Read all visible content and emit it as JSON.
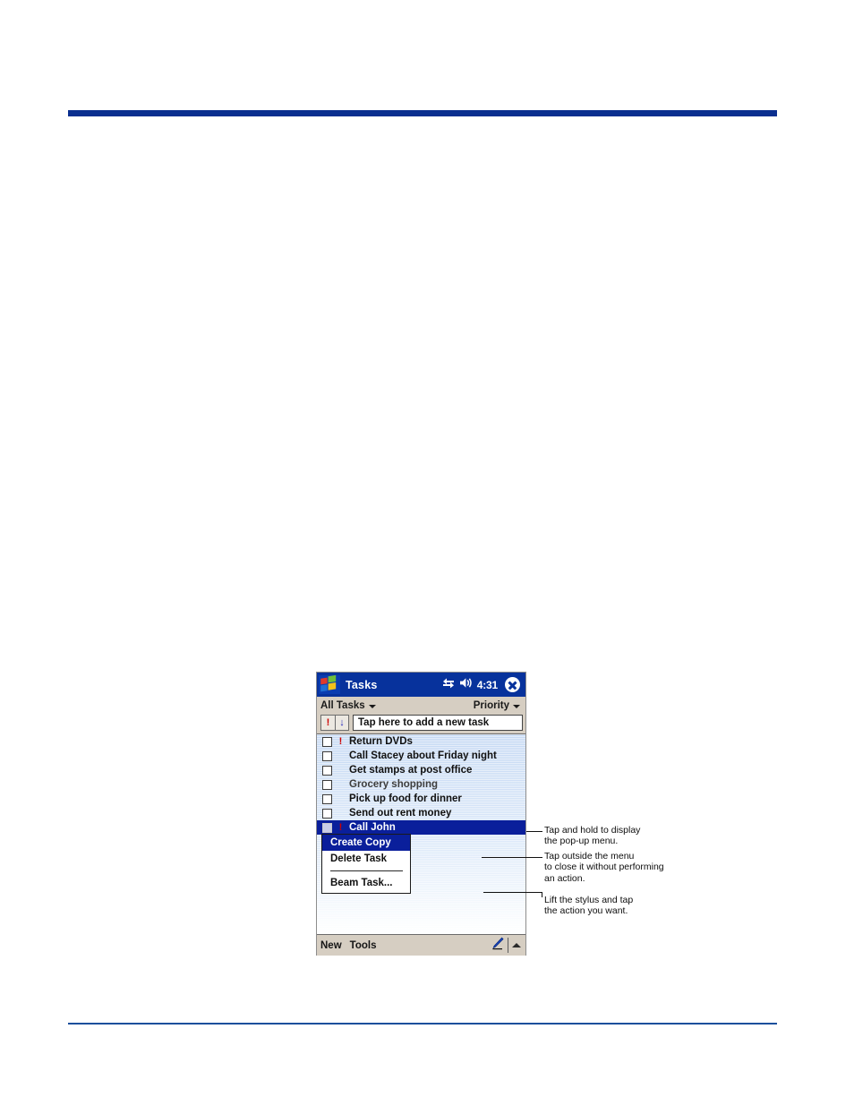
{
  "page": {
    "rule_color_top": "#0a2f8f",
    "rule_color_bottom": "#1b4f9c"
  },
  "device": {
    "titlebar": {
      "logo_icon": "windows-logo-icon",
      "title": "Tasks",
      "connectivity_icon": "connectivity-icon",
      "volume_icon": "speaker-icon",
      "clock": "4:31",
      "close_icon": "close-icon"
    },
    "filterbar": {
      "category_label": "All Tasks",
      "category_caret_icon": "chevron-down-icon",
      "sort_label": "Priority",
      "sort_caret_icon": "chevron-down-icon"
    },
    "entrybar": {
      "high_priority_glyph": "!",
      "low_priority_glyph": "↓",
      "new_task_placeholder": "Tap here to add a new task"
    },
    "tasks": [
      {
        "label": "Return DVDs",
        "priority": "!",
        "checked": false,
        "selected": false,
        "dim": false
      },
      {
        "label": "Call Stacey about Friday night",
        "priority": "",
        "checked": false,
        "selected": false,
        "dim": false
      },
      {
        "label": "Get stamps at post office",
        "priority": "",
        "checked": false,
        "selected": false,
        "dim": false
      },
      {
        "label": "Grocery shopping",
        "priority": "",
        "checked": false,
        "selected": false,
        "dim": true
      },
      {
        "label": "Pick up food for dinner",
        "priority": "",
        "checked": false,
        "selected": false,
        "dim": false
      },
      {
        "label": "Send out rent money",
        "priority": "",
        "checked": false,
        "selected": false,
        "dim": false
      },
      {
        "label": "Call John",
        "priority": "!",
        "checked": false,
        "selected": true,
        "dim": false
      }
    ],
    "context_menu": {
      "items": [
        {
          "label": "Create Copy",
          "accel": "C",
          "active": true
        },
        {
          "label": "Delete Task",
          "accel": "D",
          "active": false
        },
        {
          "label": "Beam Task...",
          "accel": "B",
          "active": false
        }
      ]
    },
    "toolbar": {
      "new_label": "New",
      "tools_label": "Tools",
      "pen_icon": "pen-icon",
      "expand_icon": "up-caret-icon"
    }
  },
  "callouts": [
    {
      "text": "Tap and hold to display\nthe pop-up menu."
    },
    {
      "text": "Tap outside the menu\nto close it without performing\nan action."
    },
    {
      "text": "Lift the stylus and tap\nthe action you want."
    }
  ]
}
